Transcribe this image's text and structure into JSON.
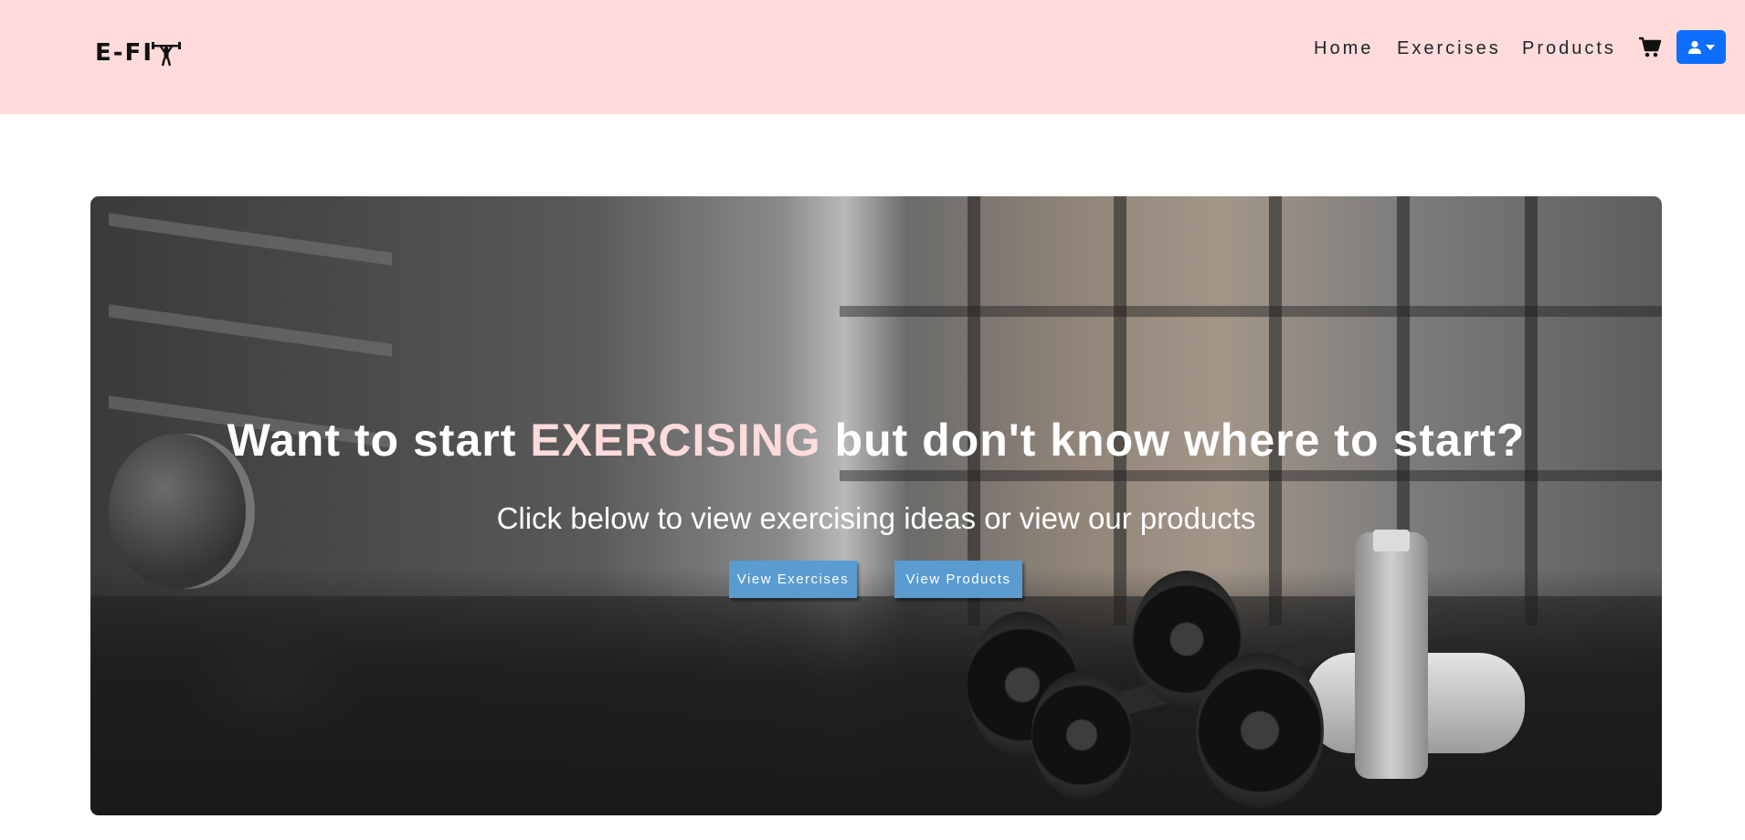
{
  "brand": {
    "logo_text": "E-FI"
  },
  "nav": {
    "links": [
      "Home",
      "Exercises",
      "Products"
    ],
    "cart_icon": "cart-icon",
    "user_icon": "user-icon",
    "user_button_color": "#0d6efd"
  },
  "hero": {
    "title_before": "Want to start ",
    "title_accent": "EXERCISING",
    "title_after": " but don't know where to start?",
    "subtitle": "Click below to view exercising ideas or view our products",
    "buttons": [
      "View Exercises",
      "View Products"
    ],
    "accent_color": "#ffdcdb",
    "button_color": "#5a9bd0"
  },
  "colors": {
    "navbar_bg": "#ffdcdb"
  }
}
